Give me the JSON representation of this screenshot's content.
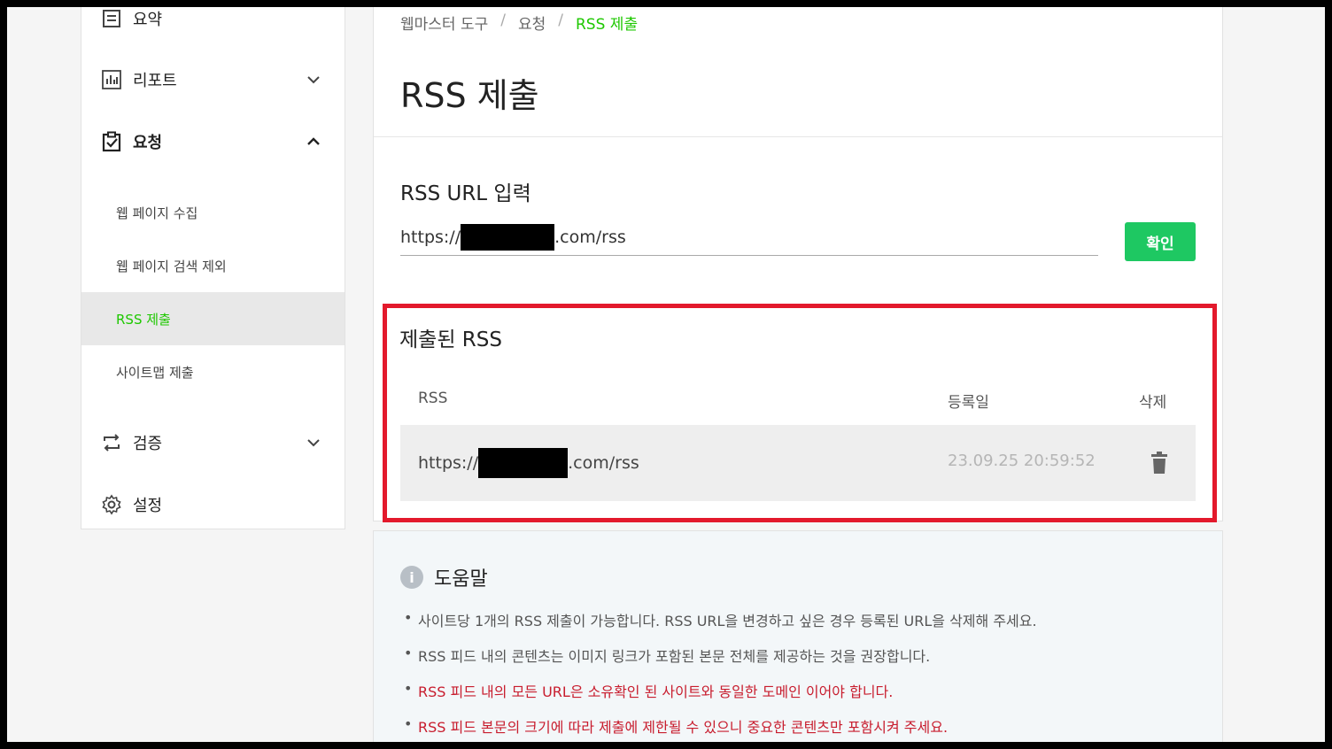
{
  "sidebar": {
    "summary_label": "요약",
    "report_label": "리포트",
    "request_label": "요청",
    "sub_items": [
      {
        "label": "웹 페이지 수집"
      },
      {
        "label": "웹 페이지 검색 제외"
      },
      {
        "label": "RSS 제출"
      },
      {
        "label": "사이트맵 제출"
      }
    ],
    "verify_label": "검증",
    "settings_label": "설정"
  },
  "breadcrumb": {
    "items": [
      "웹마스터 도구",
      "요청",
      "RSS 제출"
    ],
    "separator": "/"
  },
  "page_title": "RSS 제출",
  "rss_input": {
    "section_title": "RSS URL 입력",
    "value_prefix": "https://",
    "value_suffix": ".com/rss",
    "confirm_label": "확인"
  },
  "submitted": {
    "title": "제출된 RSS",
    "columns": [
      "RSS",
      "등록일",
      "삭제"
    ],
    "rows": [
      {
        "url_prefix": "https://",
        "url_suffix": ".com/rss",
        "date": "23.09.25 20:59:52"
      }
    ]
  },
  "help": {
    "title": "도움말",
    "items": [
      "사이트당 1개의 RSS 제출이 가능합니다. RSS URL을 변경하고 싶은 경우 등록된 URL을 삭제해 주세요.",
      "RSS 피드 내의 콘텐츠는 이미지 링크가 포함된 본문 전체를 제공하는 것을 권장합니다.",
      "RSS 피드 내의 모든 URL은 소유확인 된 사이트와 동일한 도메인 이어야 합니다.",
      "RSS 피드 본문의 크기에 따라 제출에 제한될 수 있으니 중요한 콘텐츠만 포함시켜 주세요."
    ]
  },
  "colors": {
    "accent": "#1ec800",
    "button": "#1ec862",
    "highlight_border": "#e3192c",
    "warning_text": "#c81d2e"
  }
}
